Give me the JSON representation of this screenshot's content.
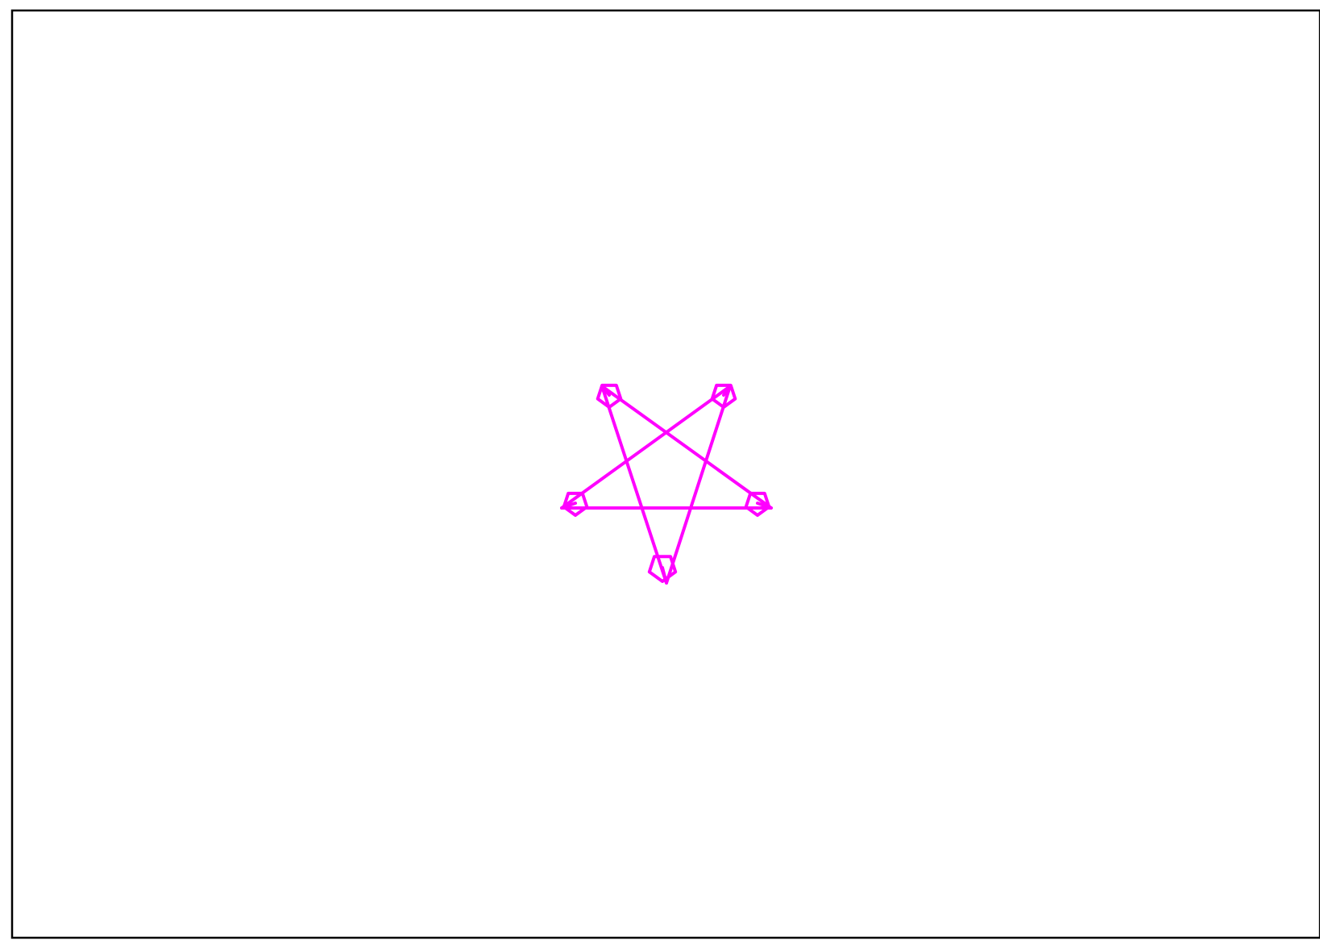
{
  "canvas": {
    "background": "#ffffff",
    "frame_color": "#000000"
  },
  "drawing": {
    "shape": "pentagram",
    "stroke_color": "#ff00ff",
    "vertex_marker": "pentagon",
    "vertex_count": 5
  }
}
